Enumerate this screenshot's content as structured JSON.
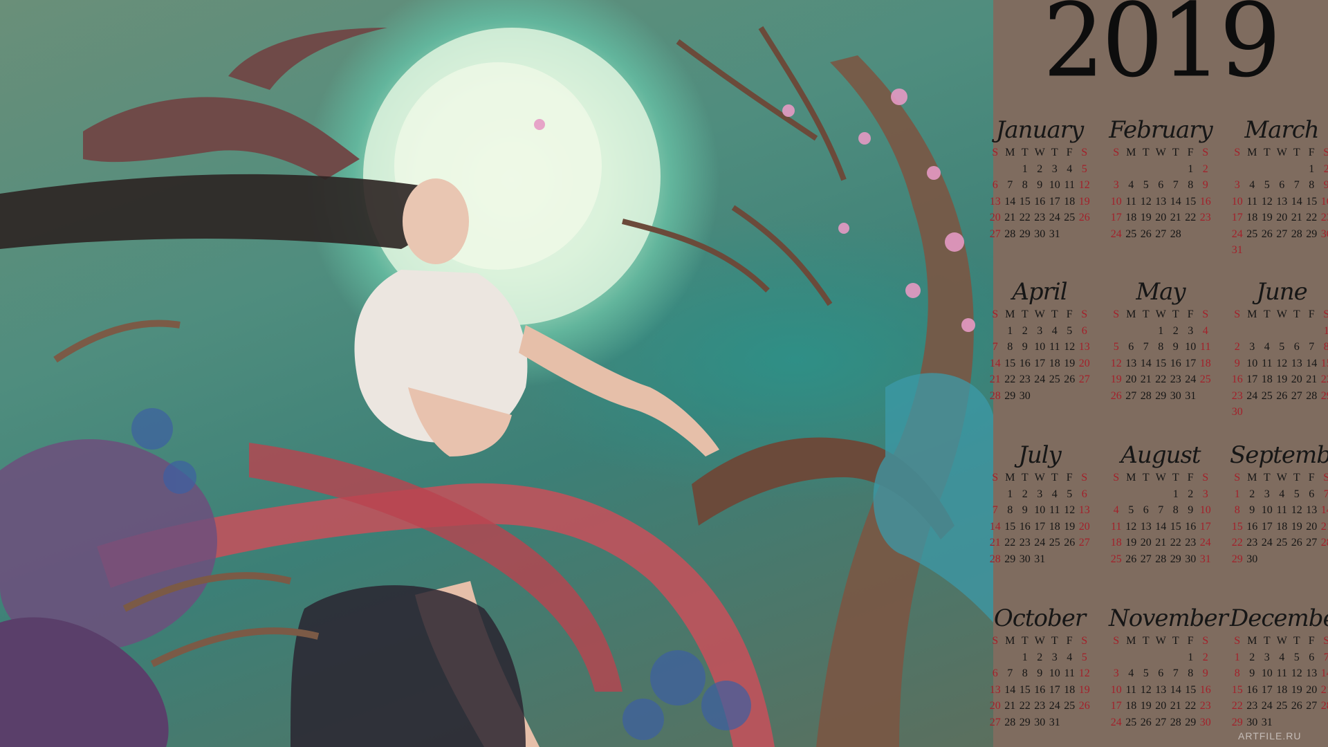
{
  "calendar": {
    "year": "2019",
    "weekday_headers": [
      "S",
      "M",
      "T",
      "W",
      "T",
      "F",
      "S"
    ],
    "weekend_color": "#a3202a",
    "text_color": "#151515",
    "panel_color": "#7f6c5f",
    "months": [
      {
        "name": "January",
        "offset": 2,
        "days": 31
      },
      {
        "name": "February",
        "offset": 5,
        "days": 28
      },
      {
        "name": "March",
        "offset": 5,
        "days": 31
      },
      {
        "name": "April",
        "offset": 1,
        "days": 30
      },
      {
        "name": "May",
        "offset": 3,
        "days": 31
      },
      {
        "name": "June",
        "offset": 6,
        "days": 30
      },
      {
        "name": "July",
        "offset": 1,
        "days": 31
      },
      {
        "name": "August",
        "offset": 4,
        "days": 31
      },
      {
        "name": "September",
        "offset": 0,
        "days": 30
      },
      {
        "name": "October",
        "offset": 2,
        "days": 31
      },
      {
        "name": "November",
        "offset": 5,
        "days": 30
      },
      {
        "name": "December",
        "offset": 0,
        "days": 31
      }
    ]
  },
  "artwork": {
    "subject": "fantasy-woman-under-moon",
    "palette": {
      "moon": "#f4fbe9",
      "sky": "#4f8d7e",
      "ribbon": "#c8505a",
      "branches": "#6b4a3a",
      "blossoms": "#e59ac4"
    }
  },
  "watermark": "ARTFILE.RU"
}
